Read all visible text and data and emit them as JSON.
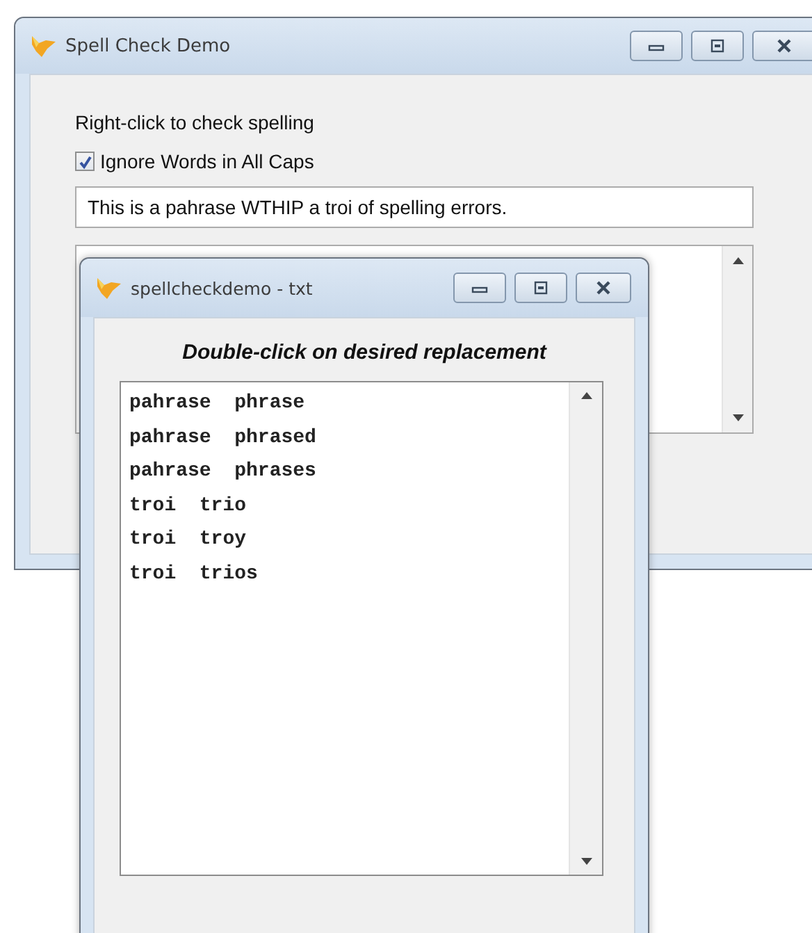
{
  "main_window": {
    "title": "Spell Check Demo",
    "instruction": "Right-click to check spelling",
    "ignore_caps": {
      "label": "Ignore Words in All Caps",
      "checked": true
    },
    "input": {
      "value": "This is a pahrase WTHIP a troi of spelling errors."
    }
  },
  "popup_window": {
    "title": "spellcheckdemo - txt",
    "heading": "Double-click on desired replacement",
    "suggestions": [
      {
        "text": "pahrase  phrase"
      },
      {
        "text": "pahrase  phrased"
      },
      {
        "text": "pahrase  phrases"
      },
      {
        "text": "troi  trio"
      },
      {
        "text": "troi  troy"
      },
      {
        "text": "troi  trios"
      }
    ]
  }
}
